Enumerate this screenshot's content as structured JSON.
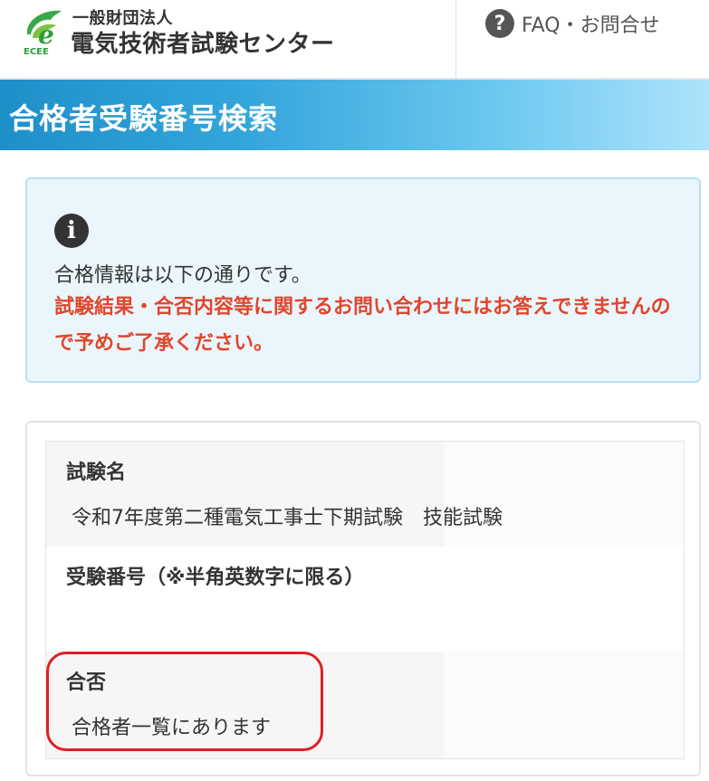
{
  "header": {
    "org_type": "一般財団法人",
    "org_name": "電気技術者試験センター",
    "logo_letter": "e",
    "logo_text": "ECEE",
    "faq_icon": "?",
    "faq_label": "FAQ・お問合せ"
  },
  "title": "合格者受験番号検索",
  "info": {
    "icon": "i",
    "message": "合格情報は以下の通りです。",
    "warning": "試験結果・合否内容等に関するお問い合わせにはお答えできませんので予めご了承ください。"
  },
  "result": {
    "fields": [
      {
        "label": "試験名",
        "value": "令和7年度第二種電気工事士下期試験　技能試験"
      },
      {
        "label": "受験番号（※半角英数字に限る）",
        "value": ""
      },
      {
        "label": "合否",
        "value": "合格者一覧にあります"
      }
    ]
  },
  "colors": {
    "accent_blue": "#34a6dc",
    "warning_red": "#e0462d",
    "logo_green": "#2e9d3a",
    "highlight_red": "#e02020"
  }
}
